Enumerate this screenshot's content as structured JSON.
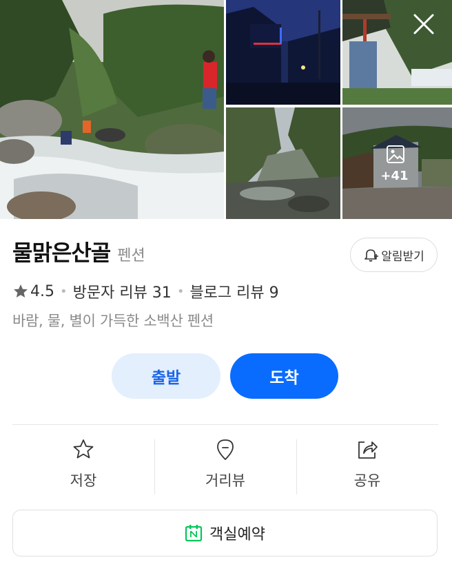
{
  "gallery": {
    "more_count": "+41"
  },
  "place": {
    "name": "물맑은산골",
    "category": "펜션",
    "rating": "4.5",
    "visitor_reviews": "방문자 리뷰 31",
    "blog_reviews": "블로그 리뷰 9",
    "description": "바람, 물, 별이 가득한 소백산 펜션"
  },
  "notify": {
    "label": "알림받기"
  },
  "route": {
    "start_label": "출발",
    "end_label": "도착"
  },
  "actions": {
    "save_label": "저장",
    "street_view_label": "거리뷰",
    "share_label": "공유"
  },
  "booking": {
    "label": "객실예약"
  },
  "colors": {
    "primary": "#0a6cff",
    "primary_light": "#e3effd",
    "naver_green": "#03c75a"
  }
}
